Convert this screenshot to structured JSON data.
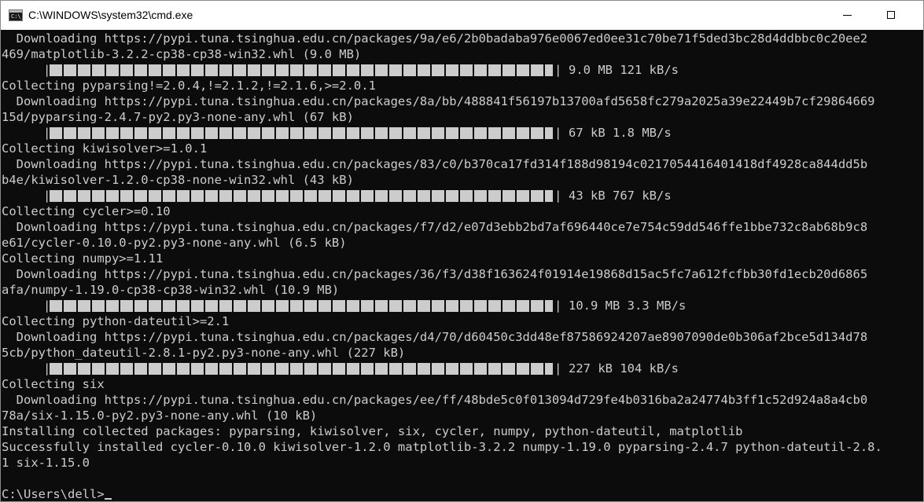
{
  "window": {
    "title": "C:\\WINDOWS\\system32\\cmd.exe",
    "app_icon_text": "C:\\_"
  },
  "console": {
    "lines": [
      {
        "type": "text",
        "text": "  Downloading https://pypi.tuna.tsinghua.edu.cn/packages/9a/e6/2b0badaba976e0067ed0ee31c70be71f5ded3bc28d4ddbbc0c20ee2"
      },
      {
        "type": "text",
        "text": "469/matplotlib-3.2.2-cp38-cp38-win32.whl (9.0 MB)"
      },
      {
        "type": "progress",
        "fill": 1.0,
        "stats": "9.0 MB 121 kB/s"
      },
      {
        "type": "text",
        "text": "Collecting pyparsing!=2.0.4,!=2.1.2,!=2.1.6,>=2.0.1"
      },
      {
        "type": "text",
        "text": "  Downloading https://pypi.tuna.tsinghua.edu.cn/packages/8a/bb/488841f56197b13700afd5658fc279a2025a39e22449b7cf29864669"
      },
      {
        "type": "text",
        "text": "15d/pyparsing-2.4.7-py2.py3-none-any.whl (67 kB)"
      },
      {
        "type": "progress",
        "fill": 1.0,
        "stats": "67 kB 1.8 MB/s"
      },
      {
        "type": "text",
        "text": "Collecting kiwisolver>=1.0.1"
      },
      {
        "type": "text",
        "text": "  Downloading https://pypi.tuna.tsinghua.edu.cn/packages/83/c0/b370ca17fd314f188d98194c0217054416401418df4928ca844dd5b"
      },
      {
        "type": "text",
        "text": "b4e/kiwisolver-1.2.0-cp38-none-win32.whl (43 kB)"
      },
      {
        "type": "progress",
        "fill": 1.0,
        "stats": "43 kB 767 kB/s"
      },
      {
        "type": "text",
        "text": "Collecting cycler>=0.10"
      },
      {
        "type": "text",
        "text": "  Downloading https://pypi.tuna.tsinghua.edu.cn/packages/f7/d2/e07d3ebb2bd7af696440ce7e754c59dd546ffe1bbe732c8ab68b9c8"
      },
      {
        "type": "text",
        "text": "e61/cycler-0.10.0-py2.py3-none-any.whl (6.5 kB)"
      },
      {
        "type": "text",
        "text": "Collecting numpy>=1.11"
      },
      {
        "type": "text",
        "text": "  Downloading https://pypi.tuna.tsinghua.edu.cn/packages/36/f3/d38f163624f01914e19868d15ac5fc7a612fcfbb30fd1ecb20d6865"
      },
      {
        "type": "text",
        "text": "afa/numpy-1.19.0-cp38-cp38-win32.whl (10.9 MB)"
      },
      {
        "type": "progress",
        "fill": 1.0,
        "stats": "10.9 MB 3.3 MB/s"
      },
      {
        "type": "text",
        "text": "Collecting python-dateutil>=2.1"
      },
      {
        "type": "text",
        "text": "  Downloading https://pypi.tuna.tsinghua.edu.cn/packages/d4/70/d60450c3dd48ef87586924207ae8907090de0b306af2bce5d134d78"
      },
      {
        "type": "text",
        "text": "5cb/python_dateutil-2.8.1-py2.py3-none-any.whl (227 kB)"
      },
      {
        "type": "progress",
        "fill": 1.0,
        "stats": "227 kB 104 kB/s"
      },
      {
        "type": "text",
        "text": "Collecting six"
      },
      {
        "type": "text",
        "text": "  Downloading https://pypi.tuna.tsinghua.edu.cn/packages/ee/ff/48bde5c0f013094d729fe4b0316ba2a24774b3ff1c52d924a8a4cb0"
      },
      {
        "type": "text",
        "text": "78a/six-1.15.0-py2.py3-none-any.whl (10 kB)"
      },
      {
        "type": "text",
        "text": "Installing collected packages: pyparsing, kiwisolver, six, cycler, numpy, python-dateutil, matplotlib"
      },
      {
        "type": "text",
        "text": "Successfully installed cycler-0.10.0 kiwisolver-1.2.0 matplotlib-3.2.2 numpy-1.19.0 pyparsing-2.4.7 python-dateutil-2.8."
      },
      {
        "type": "text",
        "text": "1 six-1.15.0"
      },
      {
        "type": "text",
        "text": ""
      },
      {
        "type": "prompt",
        "text": "C:\\Users\\dell>"
      }
    ]
  },
  "colors": {
    "console_background": "#0c0c0c",
    "console_text": "#cccccc",
    "titlebar_background": "#ffffff"
  },
  "icons": {
    "app": "cmd-app-icon",
    "minimize": "minimize-icon",
    "maximize": "maximize-icon"
  }
}
